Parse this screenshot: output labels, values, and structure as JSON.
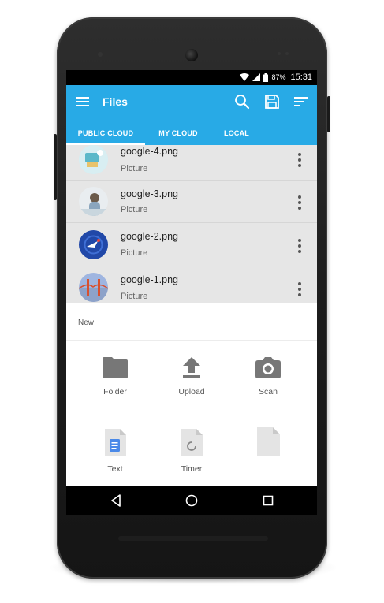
{
  "status_bar": {
    "battery": "87%",
    "time": "15:31",
    "icons": [
      "wifi-icon",
      "cell-signal-icon",
      "battery-icon"
    ]
  },
  "app_bar": {
    "title": "Files",
    "color": "#28aae6",
    "icons": [
      "menu-icon",
      "search-icon",
      "save-icon",
      "sort-icon"
    ]
  },
  "tabs": [
    {
      "label": "PUBLIC CLOUD",
      "active": true
    },
    {
      "label": "MY CLOUD",
      "active": false
    },
    {
      "label": "LOCAL",
      "active": false
    }
  ],
  "files": [
    {
      "name": "google-4.png",
      "type": "Picture"
    },
    {
      "name": "google-3.png",
      "type": "Picture"
    },
    {
      "name": "google-2.png",
      "type": "Picture"
    },
    {
      "name": "google-1.png",
      "type": "Picture"
    }
  ],
  "sheet": {
    "title": "New",
    "actions": [
      {
        "label": "Folder",
        "icon": "folder-icon"
      },
      {
        "label": "Upload",
        "icon": "upload-icon"
      },
      {
        "label": "Scan",
        "icon": "camera-icon"
      },
      {
        "label": "Text",
        "icon": "text-doc-icon"
      },
      {
        "label": "Timer",
        "icon": "timer-doc-icon"
      },
      {
        "label": "",
        "icon": "blank-doc-icon"
      }
    ]
  },
  "nav_bar": {
    "icons": [
      "back-icon",
      "home-icon",
      "recents-icon"
    ]
  }
}
